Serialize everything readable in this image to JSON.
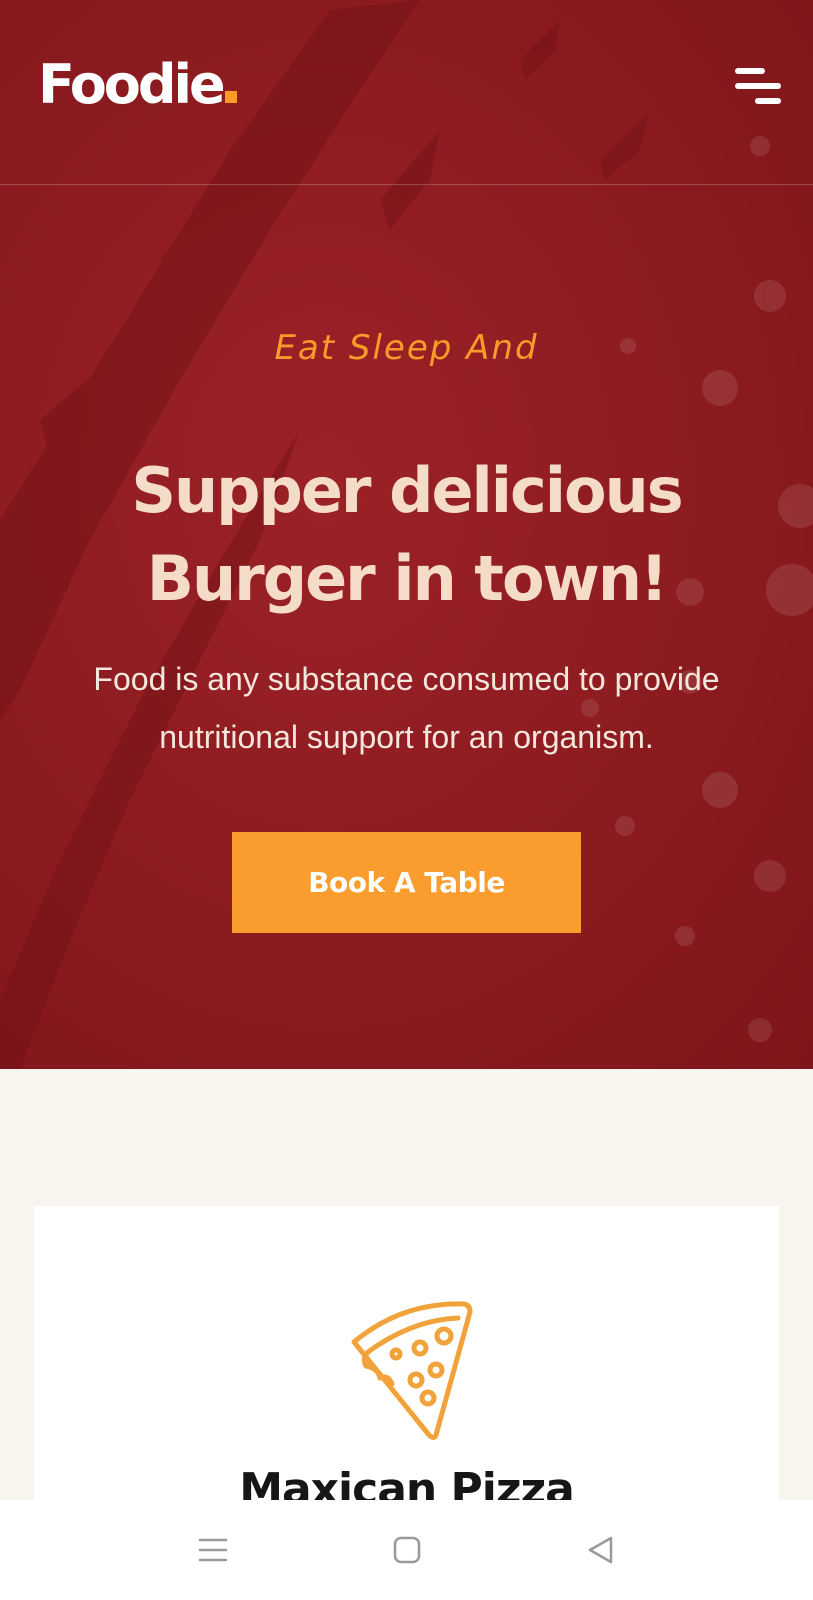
{
  "header": {
    "logo_text": "Foodie",
    "menu_icon": "hamburger-menu-icon"
  },
  "hero": {
    "tagline": "Eat Sleep And",
    "headline_line1": "Supper delicious",
    "headline_line2": "Burger in town!",
    "description_line1": "Food is any substance consumed to provide",
    "description_line2": "nutritional support for an organism.",
    "cta_label": "Book A Table"
  },
  "card": {
    "icon": "pizza-slice-icon",
    "title": "Maxican Pizza"
  },
  "system_nav": {
    "recent_icon": "recent-apps-icon",
    "home_icon": "home-icon",
    "back_icon": "back-icon"
  },
  "colors": {
    "hero_bg": "#8c1b20",
    "accent": "#fa9d2e",
    "headline": "#f5dcc9",
    "page_bg": "#f8f5ef",
    "card_bg": "#ffffff",
    "title_text": "#161616"
  }
}
